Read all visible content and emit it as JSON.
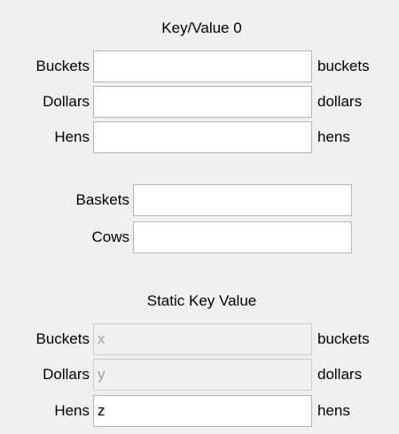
{
  "section1": {
    "heading": "Key/Value 0",
    "rows": [
      {
        "label": "Buckets",
        "value": "",
        "unit": "buckets"
      },
      {
        "label": "Dollars",
        "value": "",
        "unit": "dollars"
      },
      {
        "label": "Hens",
        "value": "",
        "unit": "hens"
      }
    ]
  },
  "section2": {
    "rows": [
      {
        "label": "Baskets",
        "value": ""
      },
      {
        "label": "Cows",
        "value": ""
      }
    ]
  },
  "section3": {
    "heading": "Static Key Value",
    "rows": [
      {
        "label": "Buckets",
        "value": "x",
        "unit": "buckets",
        "disabled": true
      },
      {
        "label": "Dollars",
        "value": "y",
        "unit": "dollars",
        "disabled": true
      },
      {
        "label": "Hens",
        "value": "z",
        "unit": "hens",
        "disabled": false
      }
    ]
  }
}
